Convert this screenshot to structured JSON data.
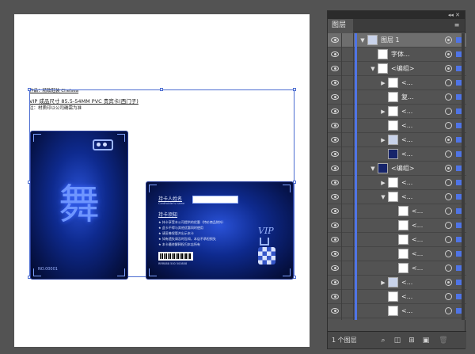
{
  "artboard": {
    "note_header": "作品：精致鞋装  Chelsea",
    "note_title": "VIP 成品尺寸 85.5-54MM PVC 贵宾卡(西门子)",
    "note_sub": "注：材质印以公司确需为准"
  },
  "card_front": {
    "calligraphy": "舞",
    "serial": "NO.00001"
  },
  "card_back": {
    "holder_label": "持卡人姓名",
    "holder_sub": "Cardholder's name",
    "notice_title": "持卡须知",
    "notice_lines": [
      "★ 持卡享受本公司提供的优惠（特价商品除外）",
      "★ 此卡不得与其他优惠同时使用",
      "★ 请妥善保管并出示本卡",
      "★ 如有遗失请及时告知，本店不承担损失",
      "★ 本卡最终解释权归本店所有"
    ],
    "vip": "VIP",
    "barcode_text": "RRR888 500 500808"
  },
  "panel": {
    "tab_label": "图层",
    "collapse_ctrl": "◂◂ ✕",
    "menu_icon": "panel-menu-icon",
    "layer_count": "1 个图层",
    "rows": [
      {
        "name": "图层 1",
        "twirl": "▼",
        "indent": 0,
        "thumb": "mid",
        "selected": true,
        "target": "filled",
        "sq": "filled"
      },
      {
        "name": "字体...",
        "twirl": "",
        "indent": 1,
        "thumb": "white",
        "selected": false,
        "target": "filled",
        "sq": "filled"
      },
      {
        "name": "<编组>",
        "twirl": "▼",
        "indent": 1,
        "thumb": "white",
        "selected": false,
        "target": "filled",
        "sq": "filled"
      },
      {
        "name": "<...",
        "twirl": "▶",
        "indent": 2,
        "thumb": "white",
        "selected": false,
        "target": "",
        "sq": "filled"
      },
      {
        "name": "复...",
        "twirl": "",
        "indent": 2,
        "thumb": "white",
        "selected": false,
        "target": "",
        "sq": "filled"
      },
      {
        "name": "<...",
        "twirl": "▶",
        "indent": 2,
        "thumb": "white",
        "selected": false,
        "target": "",
        "sq": "filled"
      },
      {
        "name": "<...",
        "twirl": "",
        "indent": 2,
        "thumb": "white",
        "selected": false,
        "target": "",
        "sq": "filled"
      },
      {
        "name": "<...",
        "twirl": "▶",
        "indent": 2,
        "thumb": "mid",
        "selected": false,
        "target": "filled",
        "sq": "filled"
      },
      {
        "name": "<...",
        "twirl": "",
        "indent": 2,
        "thumb": "dark",
        "selected": false,
        "target": "",
        "sq": "filled"
      },
      {
        "name": "<编组>",
        "twirl": "▼",
        "indent": 1,
        "thumb": "dark",
        "selected": false,
        "target": "filled",
        "sq": "filled"
      },
      {
        "name": "<...",
        "twirl": "▶",
        "indent": 2,
        "thumb": "white",
        "selected": false,
        "target": "",
        "sq": "filled"
      },
      {
        "name": "<...",
        "twirl": "▼",
        "indent": 2,
        "thumb": "white",
        "selected": false,
        "target": "",
        "sq": "filled"
      },
      {
        "name": "<...",
        "twirl": "",
        "indent": 3,
        "thumb": "white",
        "selected": false,
        "target": "",
        "sq": "filled"
      },
      {
        "name": "<...",
        "twirl": "",
        "indent": 3,
        "thumb": "white",
        "selected": false,
        "target": "",
        "sq": "filled"
      },
      {
        "name": "<...",
        "twirl": "",
        "indent": 3,
        "thumb": "white",
        "selected": false,
        "target": "",
        "sq": "filled"
      },
      {
        "name": "<...",
        "twirl": "",
        "indent": 3,
        "thumb": "white",
        "selected": false,
        "target": "",
        "sq": "filled"
      },
      {
        "name": "<...",
        "twirl": "",
        "indent": 3,
        "thumb": "white",
        "selected": false,
        "target": "",
        "sq": "filled"
      },
      {
        "name": "<...",
        "twirl": "▶",
        "indent": 2,
        "thumb": "mid",
        "selected": false,
        "target": "filled",
        "sq": "filled"
      },
      {
        "name": "<...",
        "twirl": "",
        "indent": 2,
        "thumb": "white",
        "selected": false,
        "target": "",
        "sq": "filled"
      },
      {
        "name": "<...",
        "twirl": "",
        "indent": 2,
        "thumb": "white",
        "selected": false,
        "target": "",
        "sq": "filled"
      },
      {
        "name": "<...",
        "twirl": "▶",
        "indent": 2,
        "thumb": "dark",
        "selected": false,
        "target": "filled",
        "sq": "filled"
      },
      {
        "name": "<...",
        "twirl": "",
        "indent": 2,
        "thumb": "dark",
        "selected": false,
        "target": "",
        "sq": "filled"
      }
    ],
    "footer_icons": [
      "locate-object-icon",
      "make-clipping-mask-icon",
      "new-sublayer-icon",
      "new-layer-icon",
      "delete-icon"
    ]
  },
  "colors": {
    "accent": "#4f74e6",
    "panel_bg": "#535353",
    "card_blue": "#0e2a8e"
  }
}
